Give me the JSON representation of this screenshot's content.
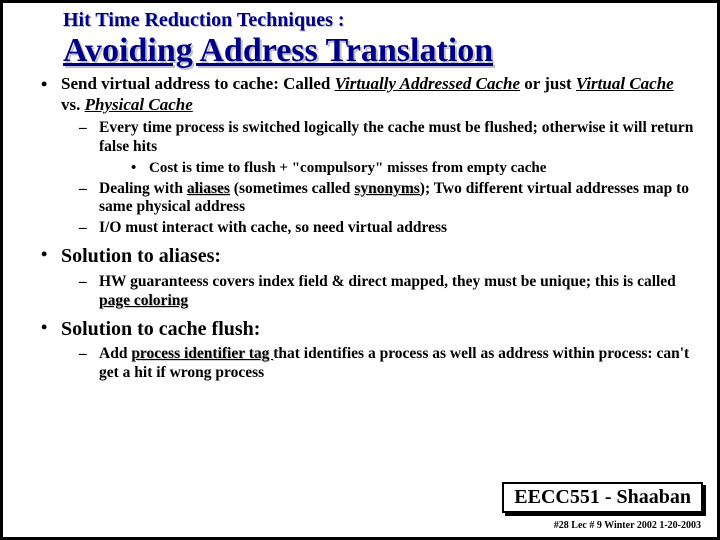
{
  "header": {
    "subtitle": "Hit Time Reduction Techniques :",
    "title": "Avoiding Address Translation"
  },
  "b1_a": "Send virtual address to cache: Called ",
  "b1_b": "Virtually Addressed Cache",
  "b1_c": " or just ",
  "b1_d": "Virtual Cache ",
  "b1_e": "vs.  ",
  "b1_f": "Physical Cache",
  "b1_s1": "Every time process is switched logically the cache must be flushed; otherwise it will return false hits",
  "b1_s1_a": "Cost is time to flush + \"compulsory\" misses from empty cache",
  "b1_s2_a": "Dealing with ",
  "b1_s2_b": "aliases",
  "b1_s2_c": " (sometimes called ",
  "b1_s2_d": "synonyms",
  "b1_s2_e": "); Two different virtual addresses map  to same physical address",
  "b1_s3": "I/O must interact with cache, so need virtual address",
  "b2": "Solution to aliases:",
  "b2_s1_a": "HW guaranteess covers index field & direct mapped, they must be unique;  this is called ",
  "b2_s1_b": "page coloring",
  "b3": "Solution to cache flush:",
  "b3_s1_a": "Add ",
  "b3_s1_b": "process identifier tag ",
  "b3_s1_c": "that identifies a process as well as address within process: can't get a hit if wrong process",
  "footer": {
    "course": "EECC551 - Shaaban",
    "line": "#28   Lec # 9   Winter 2002    1-20-2003"
  }
}
